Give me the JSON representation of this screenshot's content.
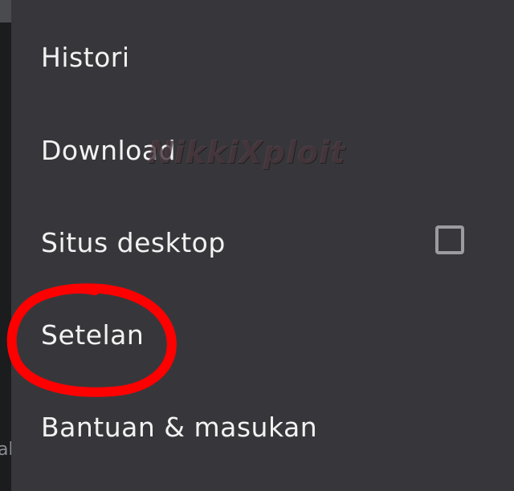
{
  "menu": {
    "items": [
      {
        "label": "Histori"
      },
      {
        "label": "Download"
      },
      {
        "label": "Situs desktop",
        "checked": false
      },
      {
        "label": "Setelan"
      },
      {
        "label": "Bantuan & masukan"
      }
    ]
  },
  "watermark": {
    "text": "NikkiXploit"
  },
  "background_fragment": {
    "text": "ak"
  },
  "annotation": {
    "color": "#ff0000",
    "target": "Setelan"
  },
  "colors": {
    "menu_background": "#37373b",
    "text": "#f2f2f2",
    "checkbox_border": "#9b9ba0"
  }
}
